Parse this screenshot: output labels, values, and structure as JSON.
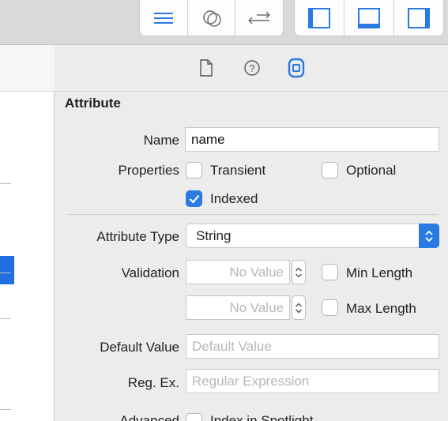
{
  "toolbar": {
    "view_buttons": [
      {
        "name": "editor-standard-icon"
      },
      {
        "name": "editor-assistant-icon"
      },
      {
        "name": "editor-version-icon"
      }
    ],
    "panel_buttons": [
      {
        "name": "navigator-panel-icon"
      },
      {
        "name": "debug-area-icon"
      },
      {
        "name": "utilities-panel-icon"
      }
    ]
  },
  "inspector": {
    "tabs": [
      {
        "name": "file-inspector-icon",
        "active": false
      },
      {
        "name": "quick-help-icon",
        "active": false
      },
      {
        "name": "data-model-inspector-icon",
        "active": true
      }
    ],
    "section_title": "Attribute",
    "name_label": "Name",
    "name_value": "name",
    "properties_label": "Properties",
    "transient_label": "Transient",
    "transient_checked": false,
    "optional_label": "Optional",
    "optional_checked": false,
    "indexed_label": "Indexed",
    "indexed_checked": true,
    "attribute_type_label": "Attribute Type",
    "attribute_type_value": "String",
    "validation_label": "Validation",
    "min_placeholder": "No Value",
    "min_length_label": "Min Length",
    "min_length_checked": false,
    "max_placeholder": "No Value",
    "max_length_label": "Max Length",
    "max_length_checked": false,
    "default_value_label": "Default Value",
    "default_value_placeholder": "Default Value",
    "regex_label": "Reg. Ex.",
    "regex_placeholder": "Regular Expression",
    "advanced_label": "Advanced",
    "spotlight_label": "Index in Spotlight",
    "spotlight_checked": false
  },
  "colors": {
    "accent": "#2a7ae2",
    "selection": "#1f6fe0"
  }
}
